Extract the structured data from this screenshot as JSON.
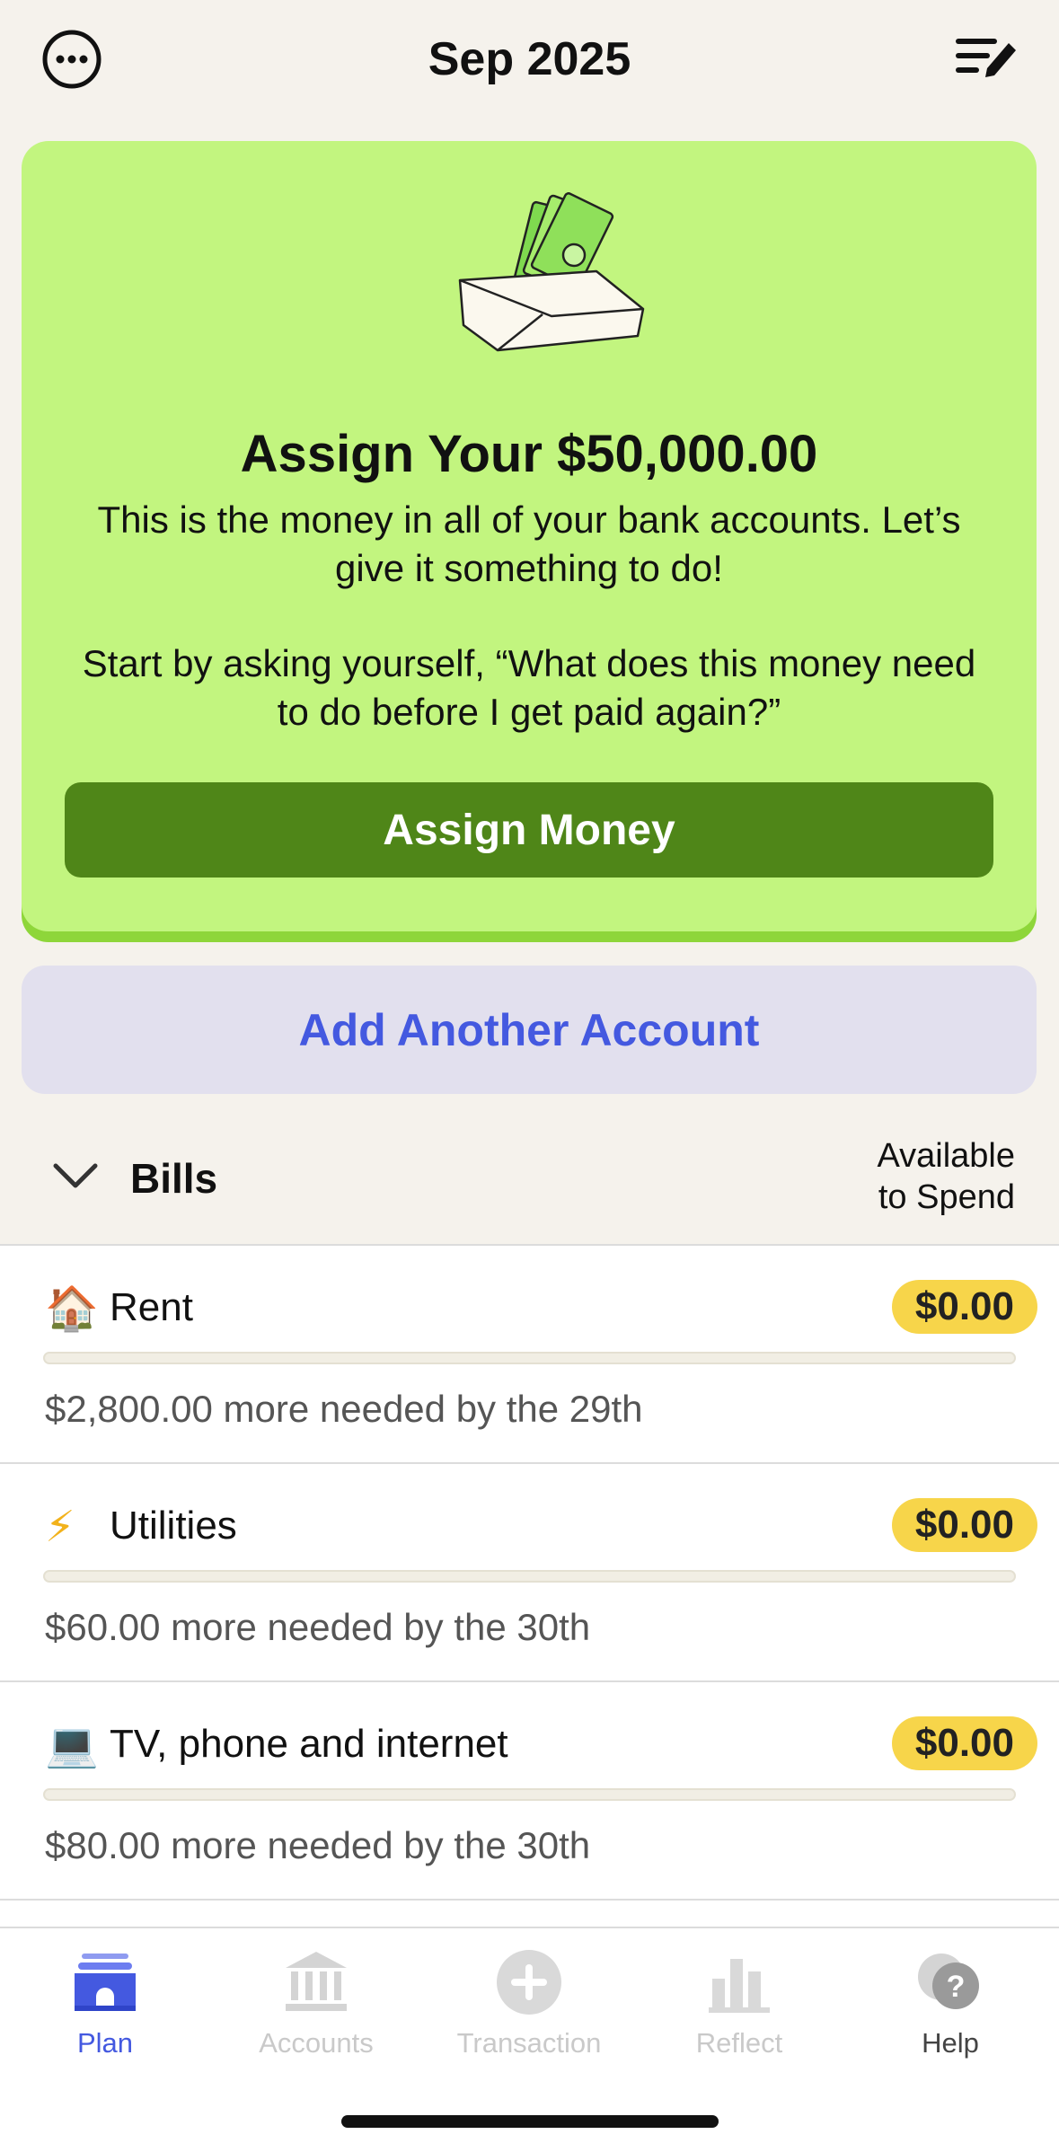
{
  "header": {
    "title": "Sep 2025",
    "more_icon": "more-dots-icon",
    "edit_icon": "edit-list-icon"
  },
  "assign_card": {
    "title": "Assign Your $50,000.00",
    "text1": "This is the money in all of your bank accounts. Let’s give it something to do!",
    "text2": "Start by asking yourself, “What does this money need to do before I get paid again?”",
    "button_label": "Assign Money",
    "bg_color": "#c2f57f",
    "button_color": "#4f8618"
  },
  "add_account": {
    "label": "Add Another Account"
  },
  "group": {
    "name": "Bills",
    "available_line1": "Available",
    "available_line2": "to Spend",
    "items": [
      {
        "emoji": "🏠",
        "name": "Rent",
        "amount": "$0.00",
        "progress": 0,
        "subtitle": "$2,800.00 more needed by the 29th"
      },
      {
        "emoji": "⚡",
        "name": "Utilities",
        "amount": "$0.00",
        "progress": 0,
        "subtitle": "$60.00 more needed by the 30th"
      },
      {
        "emoji": "💻",
        "name": "TV, phone and internet",
        "amount": "$0.00",
        "progress": 0,
        "subtitle": "$80.00 more needed by the 30th"
      }
    ]
  },
  "tabs": [
    {
      "label": "Plan",
      "icon": "plan-icon",
      "active": true
    },
    {
      "label": "Accounts",
      "icon": "bank-icon",
      "active": false
    },
    {
      "label": "Transaction",
      "icon": "plus-circle-icon",
      "active": false
    },
    {
      "label": "Reflect",
      "icon": "bar-chart-icon",
      "active": false
    },
    {
      "label": "Help",
      "icon": "help-icon",
      "active": false
    }
  ],
  "colors": {
    "accent": "#4459e0",
    "amount_badge": "#f7d54a",
    "background": "#f5f2ec"
  }
}
